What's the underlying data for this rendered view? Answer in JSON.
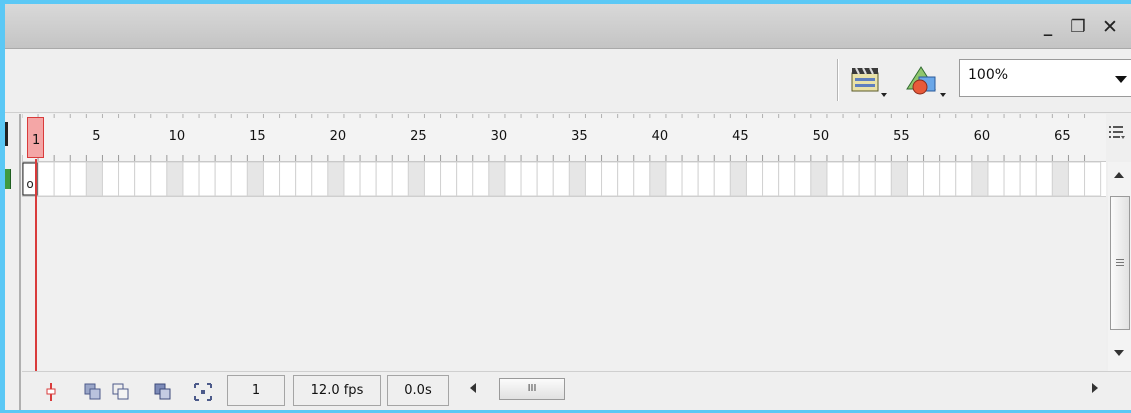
{
  "window": {
    "minimize_label": "_",
    "restore_label": "❐",
    "close_label": "✕"
  },
  "toolbar": {
    "edit_scene_icon": "clapperboard-icon",
    "edit_symbols_icon": "shapes-icon",
    "zoom_value": "100%"
  },
  "timeline": {
    "ruler_labels": [
      "1",
      "5",
      "10",
      "15",
      "20",
      "25",
      "30",
      "35",
      "40",
      "45",
      "50",
      "55",
      "60",
      "65"
    ],
    "playhead_frame": "1",
    "keyframe_symbol": "o",
    "menu_icon": "timeline-options-icon"
  },
  "status": {
    "current_frame": "1",
    "frame_rate": "12.0 fps",
    "elapsed_time": "0.0s",
    "thumb_grip": "III"
  },
  "colors": {
    "background": "#5bc8f5",
    "playhead": "#d93b3b",
    "playhead_fill": "#f4a6a6",
    "layer_marker": "#3f9a3f"
  }
}
